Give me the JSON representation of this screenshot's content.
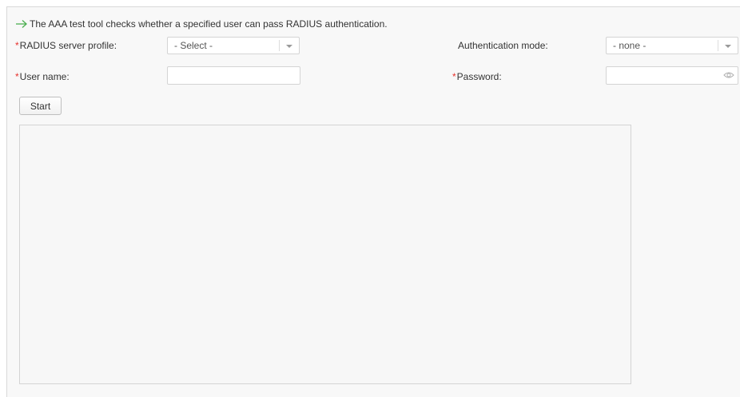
{
  "info": {
    "text": "The AAA test tool checks whether a specified user can pass RADIUS authentication.",
    "icon": "arrow-right-icon",
    "icon_color": "#4caf50"
  },
  "form": {
    "required_mark": "*",
    "radius_profile": {
      "label": "RADIUS server profile:",
      "value": "- Select -"
    },
    "auth_mode": {
      "label": "Authentication mode:",
      "value": "- none -"
    },
    "user_name": {
      "label": "User name:",
      "value": ""
    },
    "password": {
      "label": "Password:",
      "value": "",
      "icon": "eye-icon"
    },
    "start_label": "Start"
  },
  "output": {
    "value": ""
  },
  "colors": {
    "required": "#e6322d",
    "panel_bg": "#f8f8f8"
  }
}
